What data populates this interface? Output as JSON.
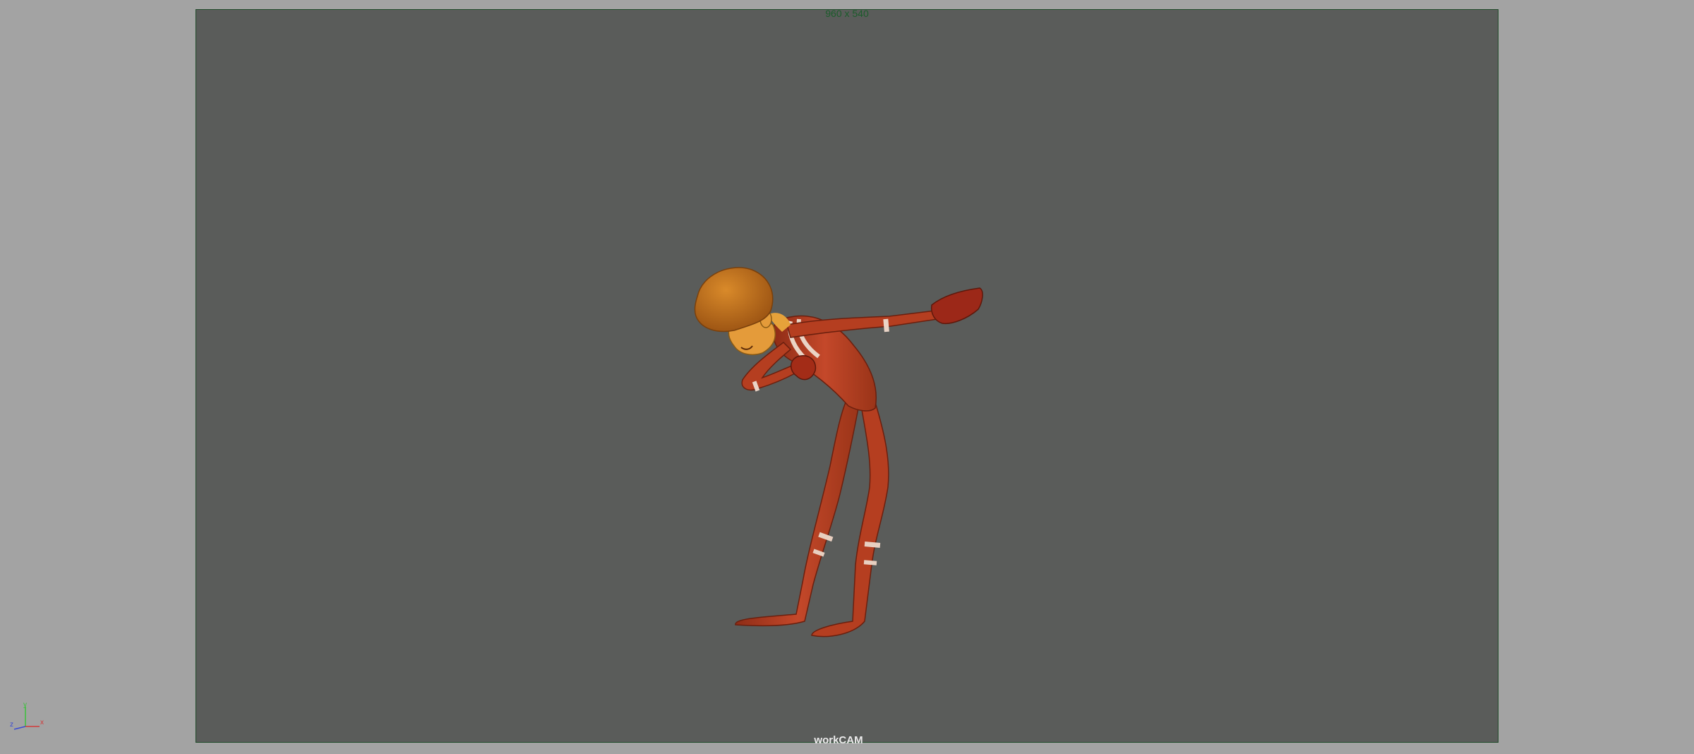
{
  "viewport": {
    "resolution_gate_label": "960 x 540",
    "camera_name": "workCAM",
    "colors": {
      "background": "#a3a3a3",
      "gate_fill": "#5a5c5a",
      "gate_border": "#1f4b2a",
      "character_body": "#b33d1f",
      "character_hair": "#c8731f"
    }
  },
  "axis_gizmo": {
    "x_label": "x",
    "y_label": "y",
    "z_label": "z",
    "colors": {
      "x": "#d23a3a",
      "y": "#3ac23a",
      "z": "#3a4ad2"
    }
  }
}
